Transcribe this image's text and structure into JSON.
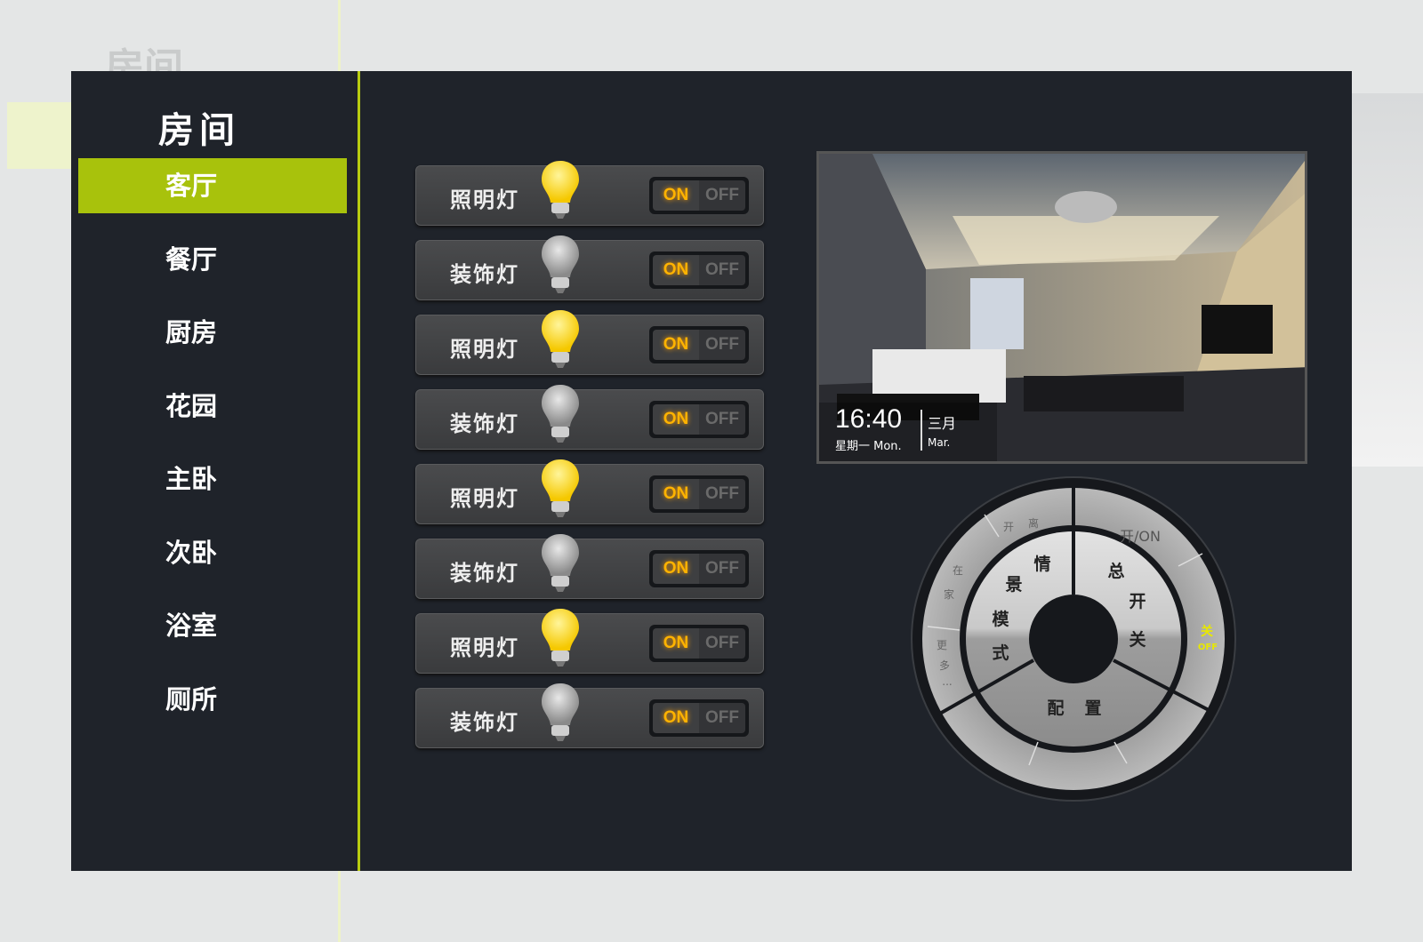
{
  "background_title": "房间",
  "sidebar": {
    "title": "房间",
    "active_index": 0,
    "items": [
      {
        "label": "客厅"
      },
      {
        "label": "餐厅"
      },
      {
        "label": "厨房"
      },
      {
        "label": "花园"
      },
      {
        "label": "主卧"
      },
      {
        "label": "次卧"
      },
      {
        "label": "浴室"
      },
      {
        "label": "厕所"
      }
    ]
  },
  "lights": [
    {
      "label": "照明灯",
      "bulb": "lit",
      "on": "ON",
      "off": "OFF",
      "state": "on"
    },
    {
      "label": "装饰灯",
      "bulb": "unlit",
      "on": "ON",
      "off": "OFF",
      "state": "on"
    },
    {
      "label": "照明灯",
      "bulb": "lit",
      "on": "ON",
      "off": "OFF",
      "state": "on"
    },
    {
      "label": "装饰灯",
      "bulb": "unlit",
      "on": "ON",
      "off": "OFF",
      "state": "on"
    },
    {
      "label": "照明灯",
      "bulb": "lit",
      "on": "ON",
      "off": "OFF",
      "state": "on"
    },
    {
      "label": "装饰灯",
      "bulb": "unlit",
      "on": "ON",
      "off": "OFF",
      "state": "on"
    },
    {
      "label": "照明灯",
      "bulb": "lit",
      "on": "ON",
      "off": "OFF",
      "state": "on"
    },
    {
      "label": "装饰灯",
      "bulb": "unlit",
      "on": "ON",
      "off": "OFF",
      "state": "on"
    }
  ],
  "photo": {
    "time": "16:40",
    "weekday": "星期一 Mon.",
    "month": "三月",
    "month_en": "Mar."
  },
  "dial": {
    "scene": [
      "情",
      "景",
      "模",
      "式"
    ],
    "master": [
      "总",
      "开",
      "关"
    ],
    "config": [
      "配",
      "置"
    ],
    "leave": [
      "开",
      "离"
    ],
    "home": [
      "在",
      "家"
    ],
    "more": [
      "更",
      "多",
      "..."
    ],
    "on_label": "开/ON",
    "off_label": "关",
    "off_en": "OFF"
  },
  "colors": {
    "accent": "#a8c20c",
    "panel": "#1f232a",
    "toggle_on": "#ffb300",
    "off_highlight": "#e8e800"
  }
}
